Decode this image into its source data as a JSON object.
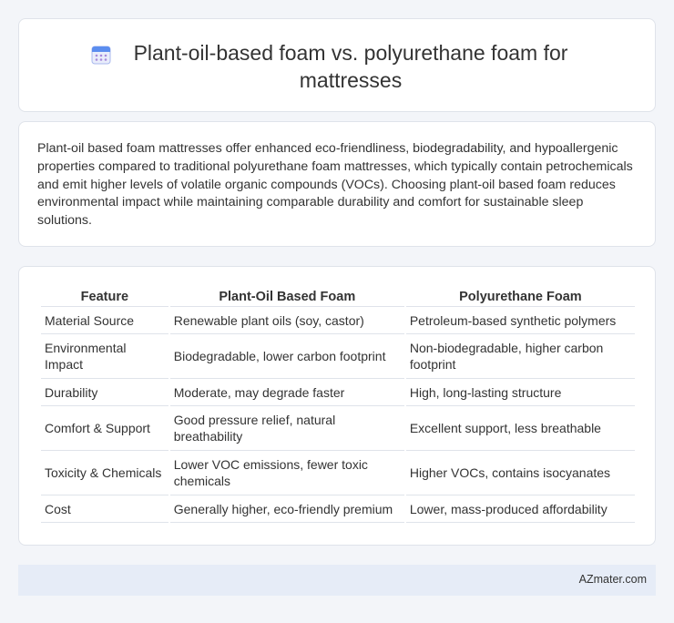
{
  "header": {
    "title": "Plant-oil-based foam vs. polyurethane foam for mattresses",
    "icon": "calendar-icon"
  },
  "summary": {
    "text": "Plant-oil based foam mattresses offer enhanced eco-friendliness, biodegradability, and hypoallergenic properties compared to traditional polyurethane foam mattresses, which typically contain petrochemicals and emit higher levels of volatile organic compounds (VOCs). Choosing plant-oil based foam reduces environmental impact while maintaining comparable durability and comfort for sustainable sleep solutions."
  },
  "table": {
    "headers": [
      "Feature",
      "Plant-Oil Based Foam",
      "Polyurethane Foam"
    ],
    "rows": [
      [
        "Material Source",
        "Renewable plant oils (soy, castor)",
        "Petroleum-based synthetic polymers"
      ],
      [
        "Environmental Impact",
        "Biodegradable, lower carbon footprint",
        "Non-biodegradable, higher carbon footprint"
      ],
      [
        "Durability",
        "Moderate, may degrade faster",
        "High, long-lasting structure"
      ],
      [
        "Comfort & Support",
        "Good pressure relief, natural breathability",
        "Excellent support, less breathable"
      ],
      [
        "Toxicity & Chemicals",
        "Lower VOC emissions, fewer toxic chemicals",
        "Higher VOCs, contains isocyanates"
      ],
      [
        "Cost",
        "Generally higher, eco-friendly premium",
        "Lower, mass-produced affordability"
      ]
    ]
  },
  "footer": {
    "brand": "AZmater.com"
  },
  "colors": {
    "background": "#f3f5f9",
    "card": "#ffffff",
    "border": "#dfe3ea",
    "footer": "#e6ecf7",
    "icon_blue": "#5b8def",
    "icon_purple": "#a78bdb"
  }
}
